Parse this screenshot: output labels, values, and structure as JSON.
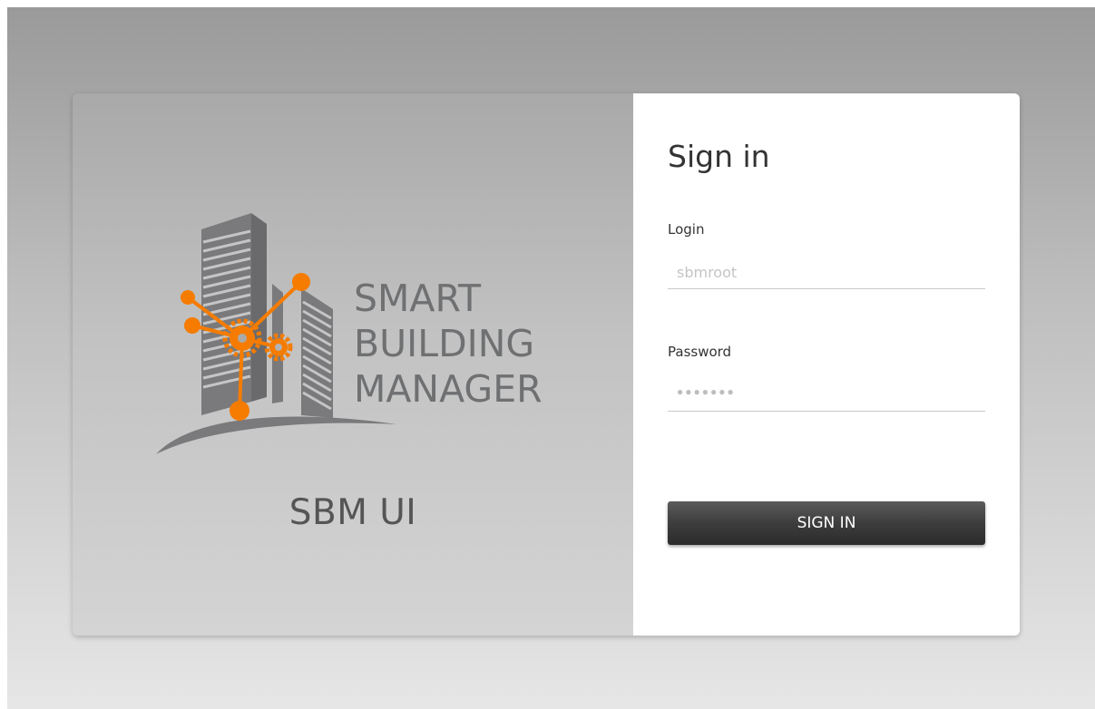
{
  "brand": {
    "logo_line1": "SMART",
    "logo_line2": "BUILDING",
    "logo_line3": "MANAGER",
    "product_name": "SBM UI",
    "accent_color": "#f57c00",
    "logo_gray": "#6f7072"
  },
  "signin": {
    "title": "Sign in",
    "login_label": "Login",
    "login_placeholder": "sbmroot",
    "password_label": "Password",
    "password_masked": "●●●●●●●",
    "button_label": "SIGN IN"
  }
}
